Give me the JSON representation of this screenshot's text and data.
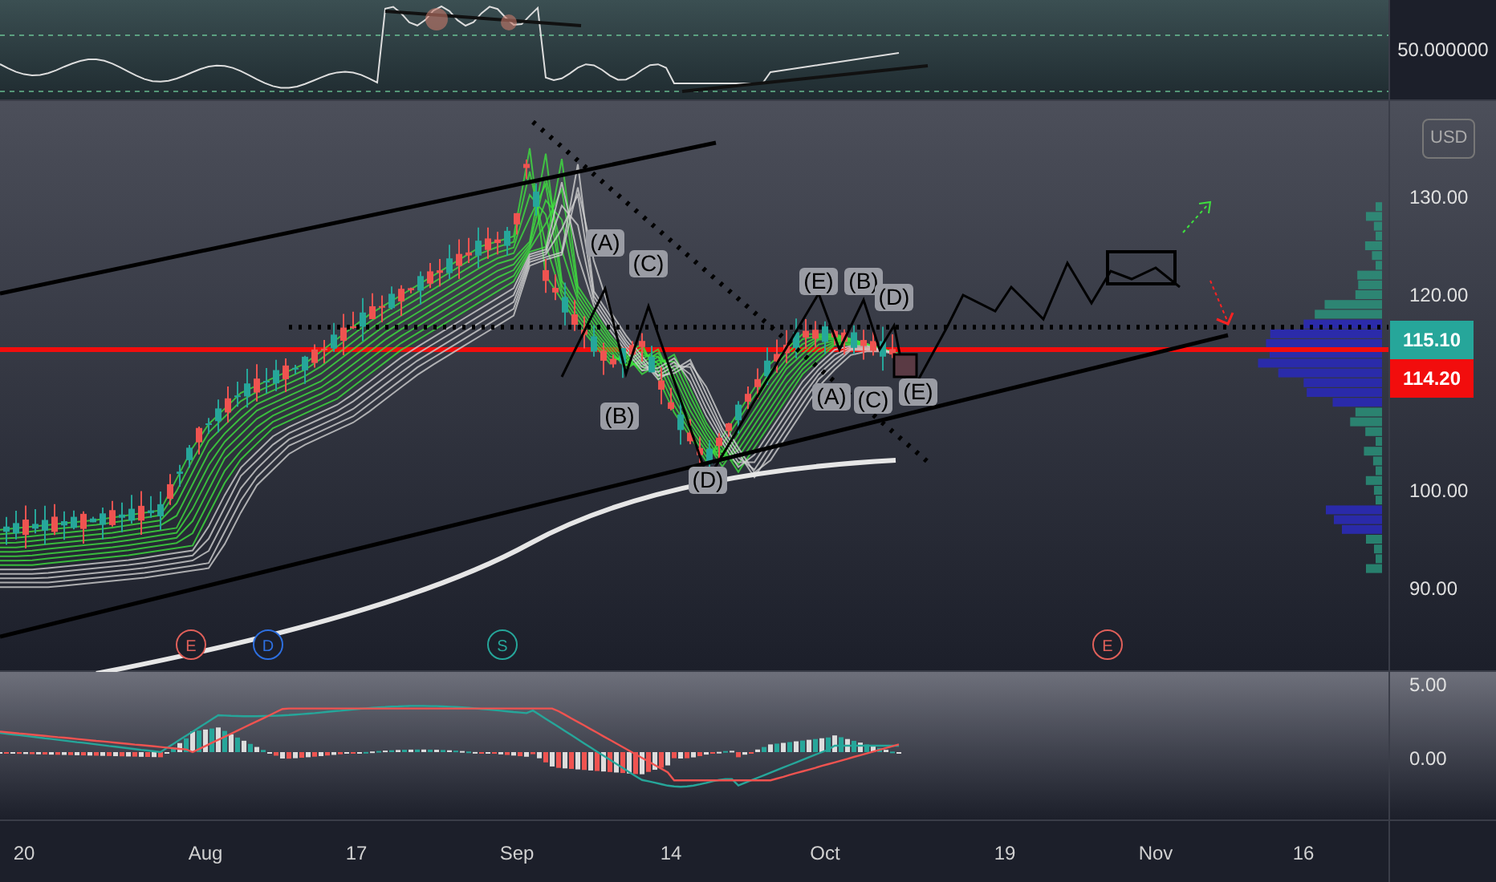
{
  "rsi_pane": {
    "axis_label": "50.000000"
  },
  "main_pane": {
    "currency_button": "USD",
    "price_ticks": [
      "130.00",
      "120.00",
      "100.00",
      "90.00"
    ],
    "price_labels": [
      {
        "text": "115.10",
        "color": "#26a69a"
      },
      {
        "text": "114.20",
        "color": "#f20d0d"
      }
    ],
    "wave_labels": [
      "(A)",
      "(C)",
      "(B)",
      "(D)",
      "(E)",
      "(B)",
      "(D)",
      "(A)",
      "(C)",
      "(E)"
    ],
    "event_markers": [
      {
        "letter": "E",
        "color": "#e0605a"
      },
      {
        "letter": "D",
        "color": "#2d6fe0"
      },
      {
        "letter": "S",
        "color": "#26a69a"
      },
      {
        "letter": "E",
        "color": "#e0605a"
      }
    ]
  },
  "macd_pane": {
    "ticks": [
      "5.00",
      "0.00"
    ]
  },
  "time_axis": [
    "20",
    "Aug",
    "17",
    "Sep",
    "14",
    "Oct",
    "19",
    "Nov",
    "16"
  ]
}
